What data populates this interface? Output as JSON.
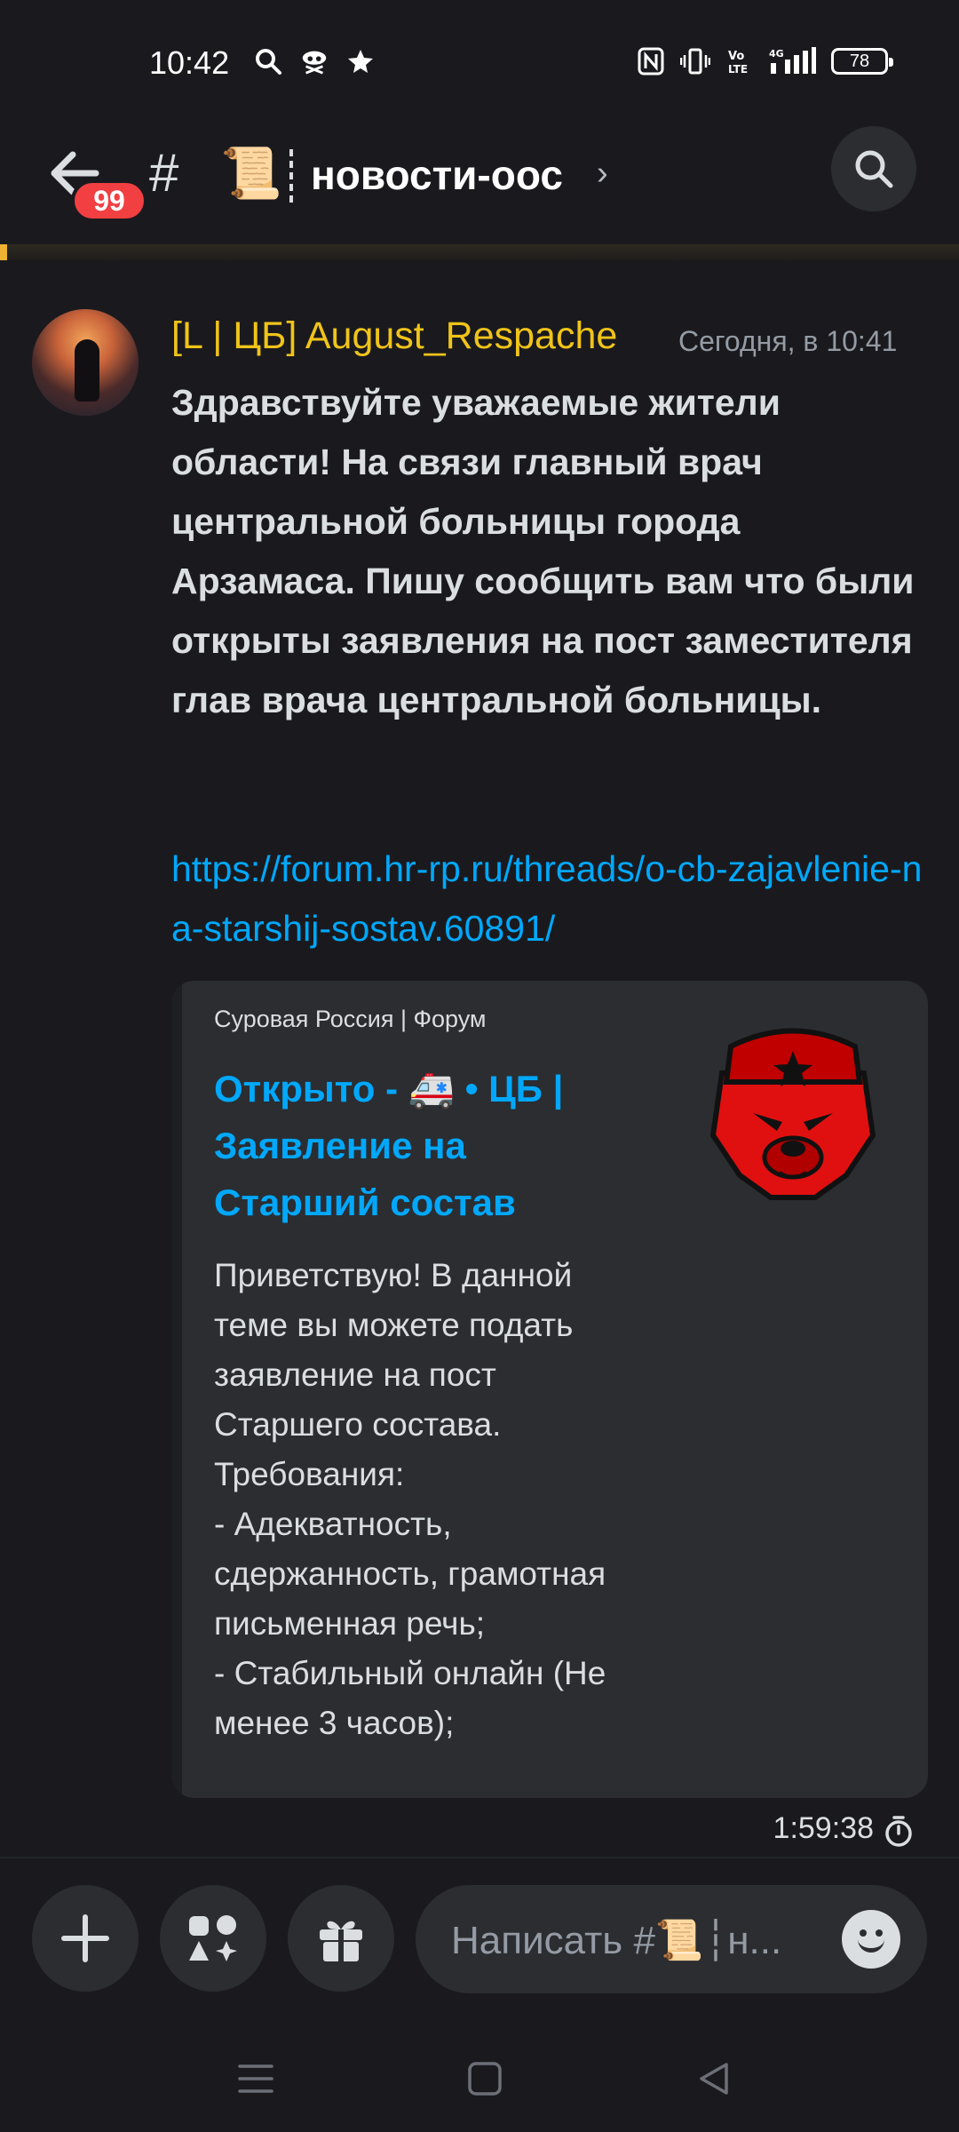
{
  "status_bar": {
    "time": "10:42",
    "left_icons": [
      "search-icon",
      "pirate-icon",
      "star-icon"
    ],
    "right_icons": [
      "nfc-icon",
      "vibrate-icon",
      "volte-icon",
      "signal-4g-icon"
    ],
    "network": "4G",
    "battery": "78"
  },
  "header": {
    "unread_badge": "99",
    "hash": "#",
    "channel_emoji": "📜",
    "channel_name": "новости-оос",
    "chevron": "›"
  },
  "message": {
    "author": "[L | ЦБ] August_Respache",
    "author_color": "#f0c419",
    "timestamp": "Сегодня, в 10:41",
    "text": "Здравствуйте уважаемые жители области! На связи главный врач центральной больницы города Арзамаса. Пишу сообщить вам что были открыты заявления на пост заместителя глав врача центральной больницы.",
    "link": "https://forum.hr-rp.ru/threads/o-cb-zajavlenie-na-starshij-sostav.60891/",
    "embed": {
      "provider": "Суровая Россия | Форум",
      "title": "Открыто - 🚑 • ЦБ | Заявление на Старший состав",
      "description": "Приветствую! В данной теме вы можете подать заявление на пост Старшего состава.\nТребования:\n- Адекватность, сдержанность, грамотная письменная речь;\n- Стабильный онлайн (Не менее 3 часов);"
    }
  },
  "timer": {
    "text": "1:59:38"
  },
  "composer": {
    "placeholder": "Написать #📜┆н..."
  },
  "colors": {
    "background": "#1a1a1e",
    "accent_link": "#00a8fc",
    "badge": "#f23f42"
  }
}
